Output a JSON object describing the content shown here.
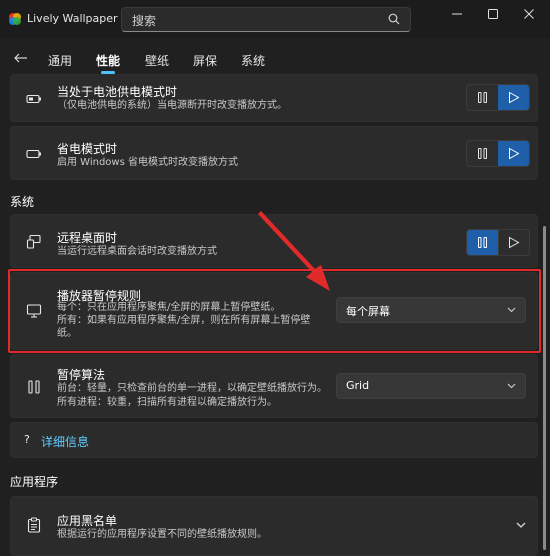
{
  "app": {
    "title": "Lively Wallpaper"
  },
  "search": {
    "placeholder": "搜索"
  },
  "tabs": [
    {
      "label": "通用"
    },
    {
      "label": "性能"
    },
    {
      "label": "壁纸"
    },
    {
      "label": "屏保"
    },
    {
      "label": "系统"
    }
  ],
  "active_tab": "性能",
  "cards": {
    "battery": {
      "title": "当处于电池供电模式时",
      "desc": "（仅电池供电的系统）当电源断开时改变播放方式。"
    },
    "power_saver": {
      "title": "省电模式时",
      "desc": "启用 Windows 省电模式时改变播放方式"
    },
    "remote": {
      "title": "远程桌面时",
      "desc": "当运行远程桌面会话时改变播放方式"
    },
    "pause_rule": {
      "title": "播放器暂停规则",
      "desc_line1": "每个：只在应用程序聚焦/全屏的屏幕上暂停壁纸。",
      "desc_line2": "所有：如果有应用程序聚焦/全屏，则在所有屏幕上暂停壁",
      "desc_line3": "纸。",
      "dropdown_value": "每个屏幕"
    },
    "pause_algo": {
      "title": "暂停算法",
      "desc_line1": "前台：轻量，只检查前台的单一进程，以确定壁纸播放行为。",
      "desc_line2": "所有进程：较重，扫描所有进程以确定播放行为。",
      "dropdown_value": "Grid"
    },
    "more_info": {
      "label": "详细信息"
    },
    "blacklist": {
      "title": "应用黑名单",
      "desc": "根据运行的应用程序设置不同的壁纸播放规则。"
    }
  },
  "sections": {
    "system": "系统",
    "apps": "应用程序"
  },
  "colors": {
    "accent": "#1f5ea8",
    "link": "#60cdff",
    "highlight": "#e12a2a"
  },
  "icons": {
    "battery": "battery-icon",
    "power_saver": "battery-saver-icon",
    "remote": "remote-desktop-icon",
    "monitor": "monitor-icon",
    "pause": "pause-icon",
    "play": "play-icon",
    "help": "question-icon",
    "blacklist": "clipboard-list-icon"
  }
}
